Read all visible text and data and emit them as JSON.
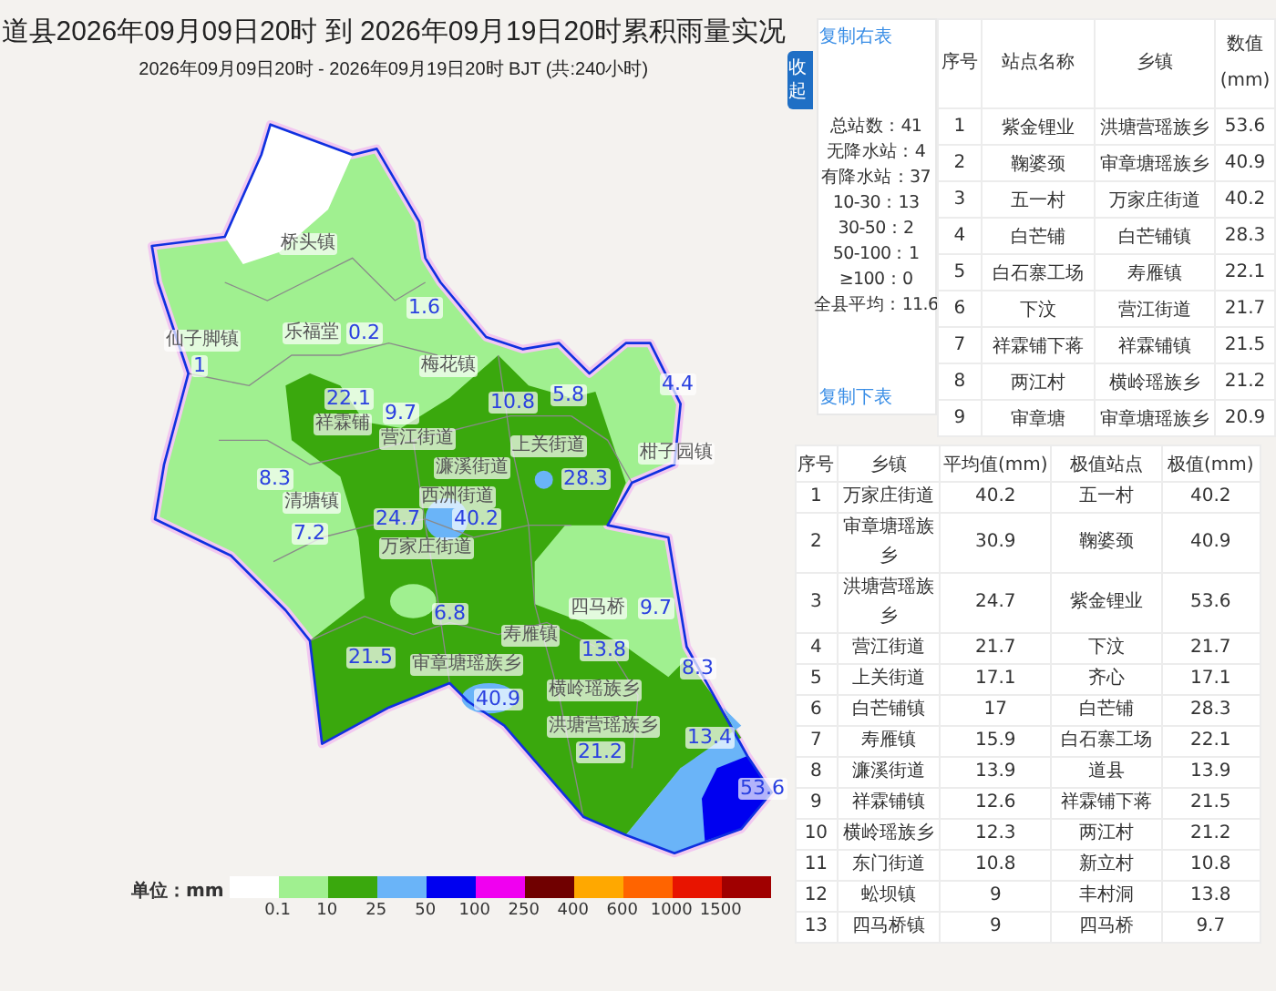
{
  "header": {
    "title": "道县2026年09月09日20时 到 2026年09月19日20时累积雨量实况",
    "subtitle": "2026年09月09日20时 - 2026年09月19日20时 BJT (共:240小时)"
  },
  "map": {
    "labels": [
      {
        "text": "桥头镇",
        "kind": "town"
      },
      {
        "text": "仙子脚镇",
        "kind": "town"
      },
      {
        "text": "1",
        "kind": "value"
      },
      {
        "text": "乐福堂",
        "kind": "town"
      },
      {
        "text": "0.2",
        "kind": "value"
      },
      {
        "text": "1.6",
        "kind": "value"
      },
      {
        "text": "梅花镇",
        "kind": "town"
      },
      {
        "text": "22.1",
        "kind": "value"
      },
      {
        "text": "祥霖铺",
        "kind": "town"
      },
      {
        "text": "9.7",
        "kind": "value"
      },
      {
        "text": "营江街道",
        "kind": "town"
      },
      {
        "text": "10.8",
        "kind": "value"
      },
      {
        "text": "5.8",
        "kind": "value"
      },
      {
        "text": "4.4",
        "kind": "value"
      },
      {
        "text": "上关街道",
        "kind": "town"
      },
      {
        "text": "濂溪街道",
        "kind": "town"
      },
      {
        "text": "柑子园镇",
        "kind": "town"
      },
      {
        "text": "8.3",
        "kind": "value"
      },
      {
        "text": "西洲街道",
        "kind": "town"
      },
      {
        "text": "28.3",
        "kind": "value"
      },
      {
        "text": "清塘镇",
        "kind": "town"
      },
      {
        "text": "7.2",
        "kind": "value"
      },
      {
        "text": "24.7",
        "kind": "value"
      },
      {
        "text": "40.2",
        "kind": "value"
      },
      {
        "text": "万家庄街道",
        "kind": "town"
      },
      {
        "text": "6.8",
        "kind": "value"
      },
      {
        "text": "四马桥",
        "kind": "town"
      },
      {
        "text": "9.7",
        "kind": "value"
      },
      {
        "text": "寿雁镇",
        "kind": "town"
      },
      {
        "text": "13.8",
        "kind": "value"
      },
      {
        "text": "21.5",
        "kind": "value"
      },
      {
        "text": "审章塘瑶族乡",
        "kind": "town"
      },
      {
        "text": "8.3",
        "kind": "value"
      },
      {
        "text": "横岭瑶族乡",
        "kind": "town"
      },
      {
        "text": "40.9",
        "kind": "value"
      },
      {
        "text": "洪塘营瑶族乡",
        "kind": "town"
      },
      {
        "text": "21.2",
        "kind": "value"
      },
      {
        "text": "13.4",
        "kind": "value"
      },
      {
        "text": "53.6",
        "kind": "value"
      }
    ]
  },
  "legend": {
    "unit_label": "单位：mm",
    "swatches": [
      {
        "color": "#ffffff"
      },
      {
        "color": "#a0f090"
      },
      {
        "color": "#3aa80d"
      },
      {
        "color": "#6ab4f8"
      },
      {
        "color": "#0000f0"
      },
      {
        "color": "#f000f0"
      },
      {
        "color": "#700000"
      },
      {
        "color": "#ffa800"
      },
      {
        "color": "#ff6400"
      },
      {
        "color": "#e81400"
      },
      {
        "color": "#a00000"
      }
    ],
    "ticks": [
      "0.1",
      "10",
      "25",
      "50",
      "100",
      "250",
      "400",
      "600",
      "1000",
      "1500"
    ]
  },
  "collapse_button": {
    "label": "收起"
  },
  "stats": {
    "copy_right_link": "复制右表",
    "lines": [
      "总站数：41",
      "无降水站：4",
      "有降水站：37",
      "10-30：13",
      "30-50：2",
      "50-100：1",
      "≥100：0",
      "全县平均：11.6"
    ],
    "copy_below_link": "复制下表"
  },
  "station_table": {
    "columns": [
      "序号",
      "站点名称",
      "乡镇",
      "数值(mm)"
    ],
    "rows": [
      [
        "1",
        "紫金锂业",
        "洪塘营瑶族乡",
        "53.6"
      ],
      [
        "2",
        "鞠婆颈",
        "审章塘瑶族乡",
        "40.9"
      ],
      [
        "3",
        "五一村",
        "万家庄街道",
        "40.2"
      ],
      [
        "4",
        "白芒铺",
        "白芒铺镇",
        "28.3"
      ],
      [
        "5",
        "白石寨工场",
        "寿雁镇",
        "22.1"
      ],
      [
        "6",
        "下汶",
        "营江街道",
        "21.7"
      ],
      [
        "7",
        "祥霖铺下蒋",
        "祥霖铺镇",
        "21.5"
      ],
      [
        "8",
        "两江村",
        "横岭瑶族乡",
        "21.2"
      ],
      [
        "9",
        "审章塘",
        "审章塘瑶族乡",
        "20.9"
      ]
    ]
  },
  "town_table": {
    "columns": [
      "序号",
      "乡镇",
      "平均值(mm)",
      "极值站点",
      "极值(mm)"
    ],
    "rows": [
      [
        "1",
        "万家庄街道",
        "40.2",
        "五一村",
        "40.2"
      ],
      [
        "2",
        "审章塘瑶族乡",
        "30.9",
        "鞠婆颈",
        "40.9"
      ],
      [
        "3",
        "洪塘营瑶族乡",
        "24.7",
        "紫金锂业",
        "53.6"
      ],
      [
        "4",
        "营江街道",
        "21.7",
        "下汶",
        "21.7"
      ],
      [
        "5",
        "上关街道",
        "17.1",
        "齐心",
        "17.1"
      ],
      [
        "6",
        "白芒铺镇",
        "17",
        "白芒铺",
        "28.3"
      ],
      [
        "7",
        "寿雁镇",
        "15.9",
        "白石寨工场",
        "22.1"
      ],
      [
        "8",
        "濂溪街道",
        "13.9",
        "道县",
        "13.9"
      ],
      [
        "9",
        "祥霖铺镇",
        "12.6",
        "祥霖铺下蒋",
        "21.5"
      ],
      [
        "10",
        "横岭瑶族乡",
        "12.3",
        "两江村",
        "21.2"
      ],
      [
        "11",
        "东门街道",
        "10.8",
        "新立村",
        "10.8"
      ],
      [
        "12",
        "蚣坝镇",
        "9",
        "丰村洞",
        "13.8"
      ],
      [
        "13",
        "四马桥镇",
        "9",
        "四马桥",
        "9.7"
      ]
    ]
  }
}
